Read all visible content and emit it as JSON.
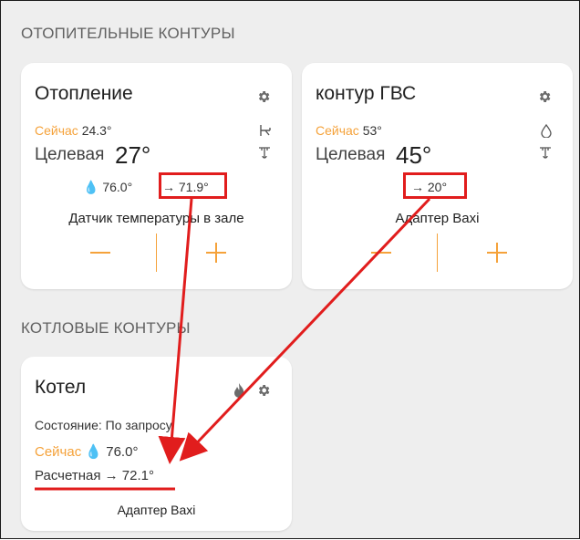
{
  "sections": {
    "heating_title": "ОТОПИТЕЛЬНЫЕ КОНТУРЫ",
    "boiler_title": "КОТЛОВЫЕ КОНТУРЫ"
  },
  "cards": {
    "heating": {
      "title": "Отопление",
      "now_label": "Сейчас",
      "now_value": "24.3°",
      "target_label": "Целевая",
      "target_value": "27°",
      "drop_value": "76.0°",
      "arrow_value": "→ 71.9°",
      "sensor": "Датчик температуры в зале"
    },
    "dhw": {
      "title": "контур ГВС",
      "now_label": "Сейчас",
      "now_value": "53°",
      "target_label": "Целевая",
      "target_value": "45°",
      "arrow_value": "→ 20°",
      "sensor": "Адаптер Baxi"
    },
    "boiler": {
      "title": "Котел",
      "state": "Состояние: По запросу",
      "now_label": "Сейчас",
      "now_value": "76.0°",
      "calc": "Расчетная → 72.1°",
      "sensor": "Адаптер Baxi"
    }
  },
  "colors": {
    "accent": "#f5a23a",
    "annotation": "#e11d1d",
    "background": "#eeeeee",
    "card": "#ffffff"
  },
  "icons": [
    "gear-icon",
    "radiator-icon",
    "thermostat-icon",
    "drop-icon",
    "flame-icon"
  ]
}
